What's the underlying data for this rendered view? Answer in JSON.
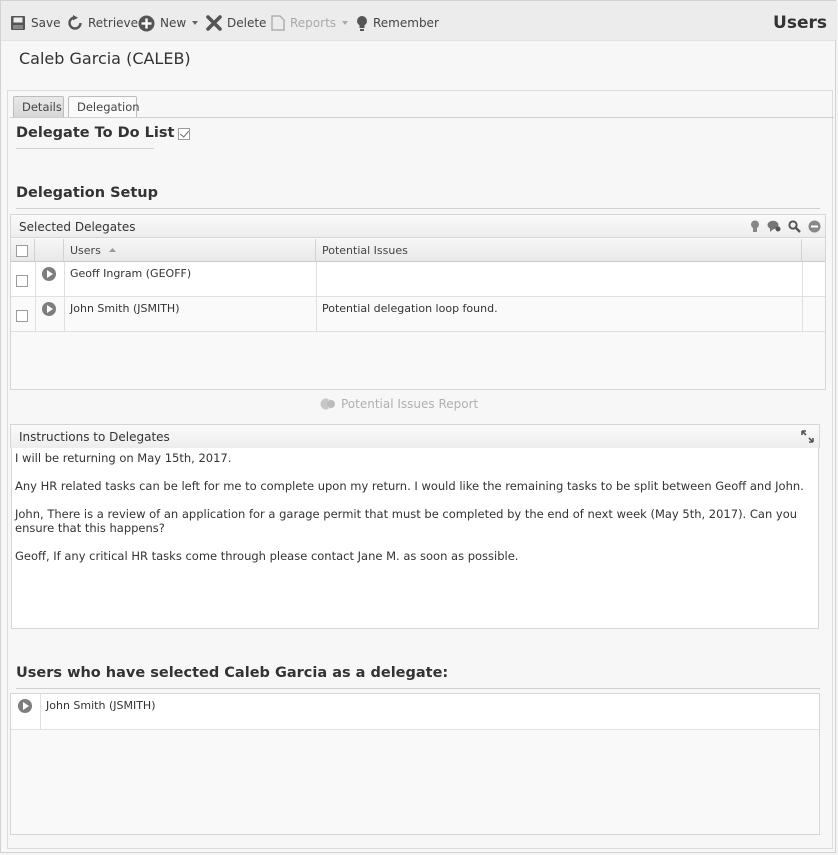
{
  "toolbar": {
    "save": "Save",
    "retrieve": "Retrieve",
    "new": "New",
    "delete": "Delete",
    "reports": "Reports",
    "remember": "Remember"
  },
  "page_heading": "Users",
  "record_title": "Caleb Garcia (CALEB)",
  "tabs": [
    "Details",
    "Delegation"
  ],
  "delegate_todo": {
    "label": "Delegate To Do List",
    "checked": true
  },
  "delegation_setup": {
    "title": "Delegation Setup"
  },
  "selected_delegates": {
    "title": "Selected Delegates",
    "columns": [
      "Users",
      "Potential Issues"
    ],
    "rows": [
      {
        "user": "Geoff Ingram (GEOFF)",
        "issue": ""
      },
      {
        "user": "John Smith (JSMITH)",
        "issue": "Potential delegation loop found."
      }
    ]
  },
  "potential_issues_report": "Potential Issues Report",
  "instructions": {
    "title": "Instructions to Delegates",
    "paragraphs": [
      "I will be returning on May 15th, 2017.",
      "Any HR related tasks can be left for me to complete upon my return.  I would like the remaining tasks to be split between Geoff and John.",
      "John, There is a review of an application for a garage permit that must be completed by the end of next week (May 5th, 2017).  Can you ensure that this happens?",
      "Geoff, If any critical HR tasks come through please contact Jane M. as soon as possible."
    ]
  },
  "delegated_by": {
    "title": "Users who have selected Caleb Garcia as a delegate:",
    "rows": [
      "John Smith (JSMITH)"
    ]
  }
}
